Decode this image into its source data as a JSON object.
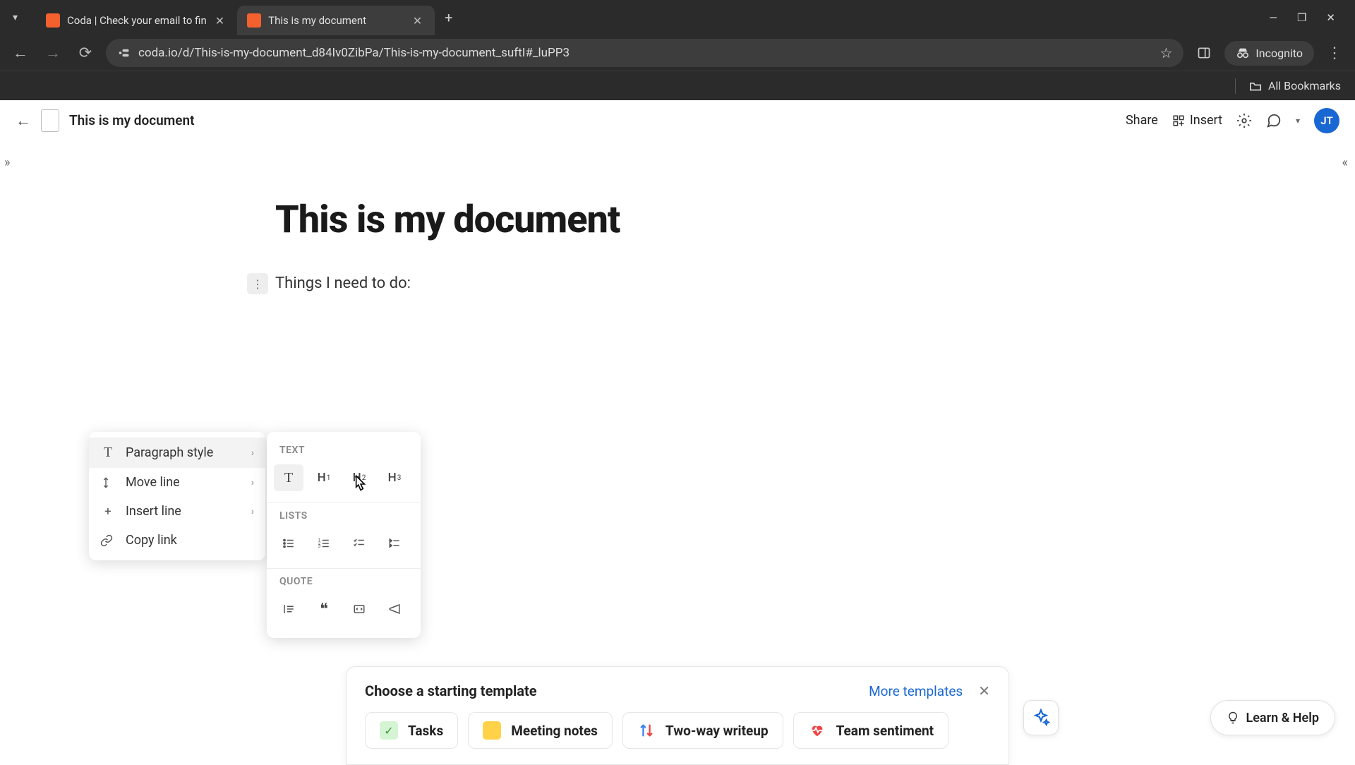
{
  "browser": {
    "tabs": [
      {
        "title": "Coda | Check your email to fin"
      },
      {
        "title": "This is my document"
      }
    ],
    "url": "coda.io/d/This-is-my-document_d84Iv0ZibPa/This-is-my-document_suftI#_luPP3",
    "incognito_label": "Incognito",
    "all_bookmarks": "All Bookmarks"
  },
  "header": {
    "doc_title": "This is my document",
    "share": "Share",
    "insert": "Insert",
    "avatar": "JT"
  },
  "document": {
    "title": "This is my document",
    "line1": "Things I need to do:"
  },
  "context_menu": {
    "items": [
      {
        "label": "Paragraph style",
        "has_submenu": true,
        "icon": "T"
      },
      {
        "label": "Move line",
        "has_submenu": true,
        "icon": "arrows"
      },
      {
        "label": "Insert line",
        "has_submenu": true,
        "icon": "plus"
      },
      {
        "label": "Copy link",
        "has_submenu": false,
        "icon": "link"
      }
    ]
  },
  "style_menu": {
    "sections": {
      "text": "TEXT",
      "lists": "LISTS",
      "quote": "QUOTE"
    },
    "text_options": [
      "T",
      "H1",
      "H2",
      "H3"
    ]
  },
  "templates": {
    "title": "Choose a starting template",
    "more_label": "More templates",
    "items": [
      {
        "label": "Tasks"
      },
      {
        "label": "Meeting notes"
      },
      {
        "label": "Two-way writeup"
      },
      {
        "label": "Team sentiment"
      }
    ]
  },
  "help": {
    "label": "Learn & Help"
  }
}
